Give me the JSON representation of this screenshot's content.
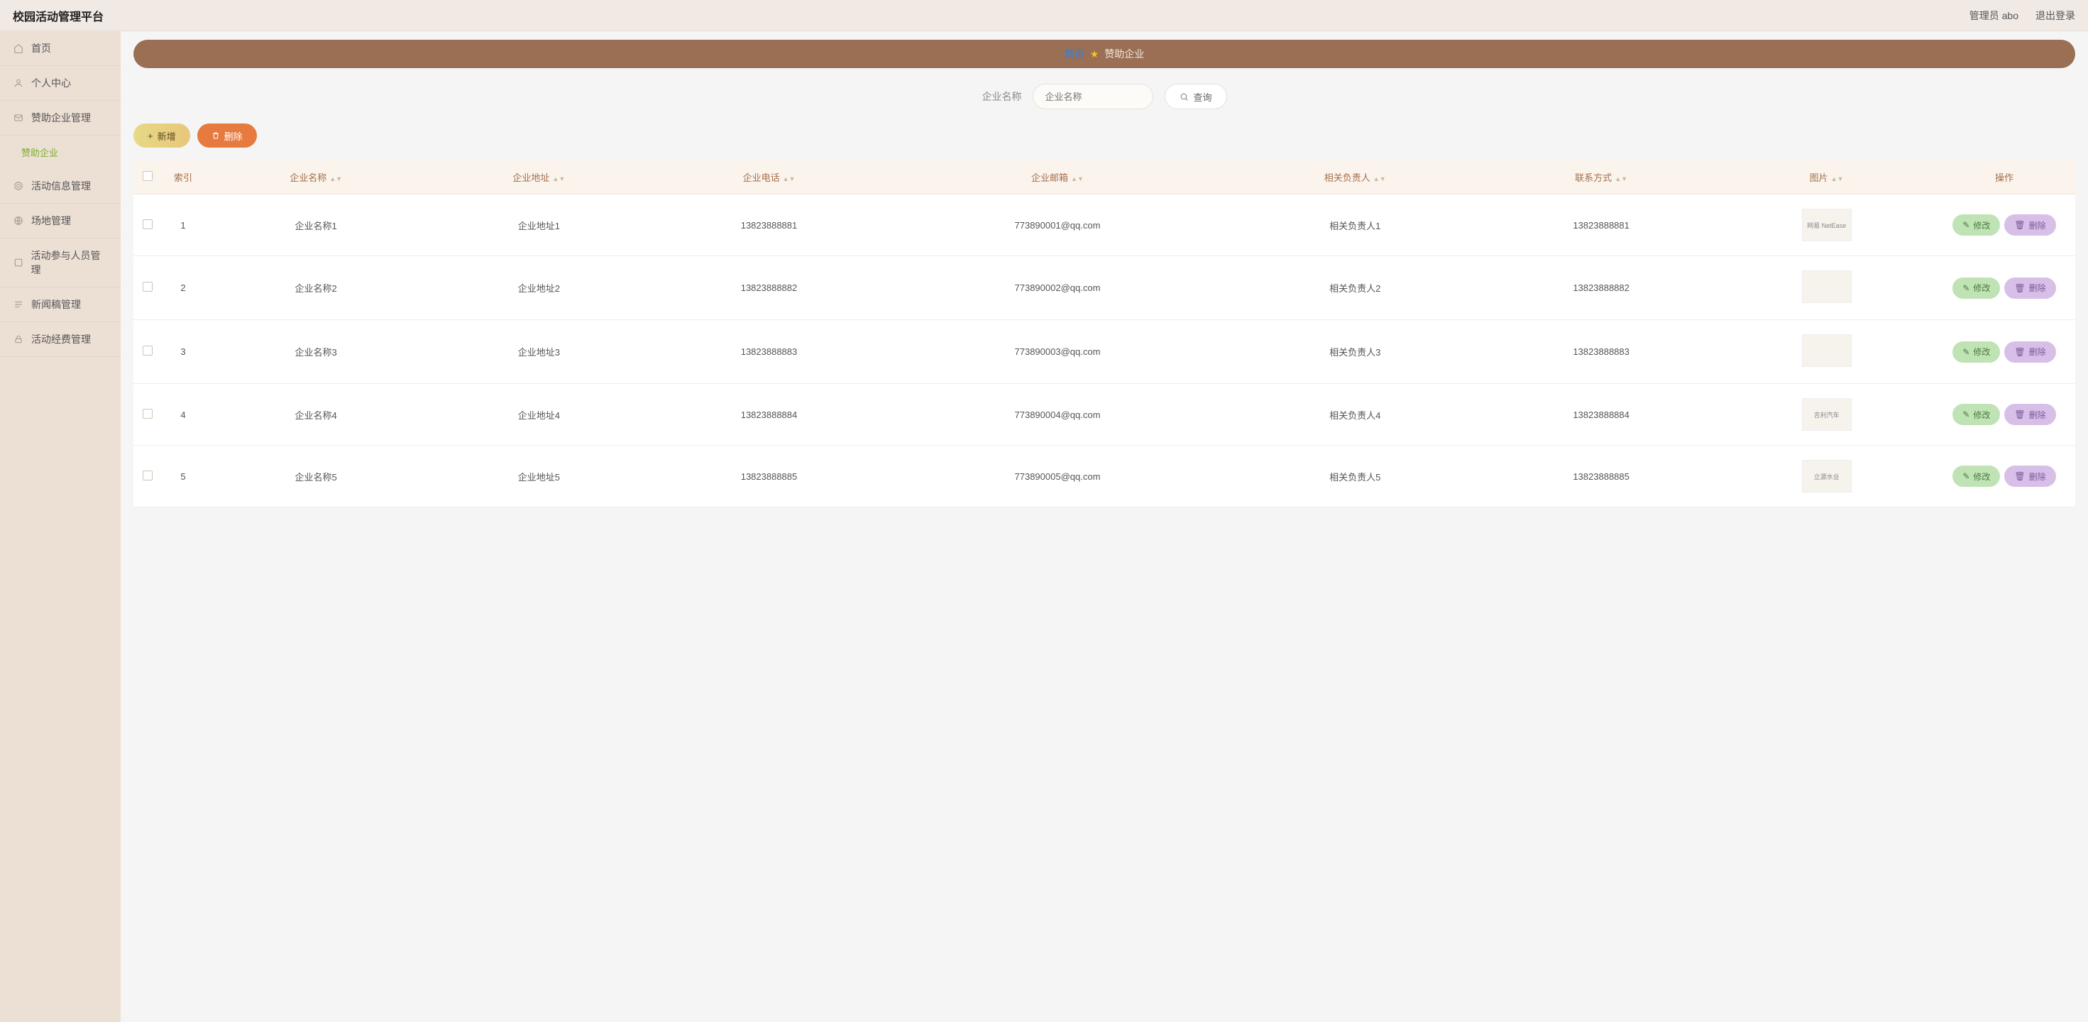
{
  "app": {
    "title": "校园活动管理平台"
  },
  "header": {
    "admin_label": "管理员 abo",
    "logout_label": "退出登录"
  },
  "sidebar": {
    "items": [
      {
        "icon": "home-icon",
        "label": "首页"
      },
      {
        "icon": "user-icon",
        "label": "个人中心"
      },
      {
        "icon": "mail-icon",
        "label": "赞助企业管理"
      },
      {
        "icon": "target-icon",
        "label": "活动信息管理"
      },
      {
        "icon": "globe-icon",
        "label": "场地管理"
      },
      {
        "icon": "people-icon",
        "label": "活动参与人员管理"
      },
      {
        "icon": "doc-icon",
        "label": "新闻稿管理"
      },
      {
        "icon": "lock-icon",
        "label": "活动经费管理"
      }
    ],
    "sub_active": "赞助企业"
  },
  "breadcrumb": {
    "home": "首页",
    "sep_star": "★",
    "current": "赞助企业"
  },
  "filter": {
    "label": "企业名称",
    "placeholder": "企业名称",
    "query_btn": "查询"
  },
  "actions": {
    "add": "新增",
    "delete": "删除"
  },
  "table": {
    "columns": [
      "索引",
      "企业名称",
      "企业地址",
      "企业电话",
      "企业邮箱",
      "相关负责人",
      "联系方式",
      "图片",
      "操作"
    ],
    "op_edit": "修改",
    "op_delete": "删除",
    "rows": [
      {
        "idx": "1",
        "name": "企业名称1",
        "addr": "企业地址1",
        "phone": "13823888881",
        "email": "773890001@qq.com",
        "person": "相关负责人1",
        "contact": "13823888881",
        "img": "网易 NetEase"
      },
      {
        "idx": "2",
        "name": "企业名称2",
        "addr": "企业地址2",
        "phone": "13823888882",
        "email": "773890002@qq.com",
        "person": "相关负责人2",
        "contact": "13823888882",
        "img": ""
      },
      {
        "idx": "3",
        "name": "企业名称3",
        "addr": "企业地址3",
        "phone": "13823888883",
        "email": "773890003@qq.com",
        "person": "相关负责人3",
        "contact": "13823888883",
        "img": ""
      },
      {
        "idx": "4",
        "name": "企业名称4",
        "addr": "企业地址4",
        "phone": "13823888884",
        "email": "773890004@qq.com",
        "person": "相关负责人4",
        "contact": "13823888884",
        "img": "吉利汽车"
      },
      {
        "idx": "5",
        "name": "企业名称5",
        "addr": "企业地址5",
        "phone": "13823888885",
        "email": "773890005@qq.com",
        "person": "相关负责人5",
        "contact": "13823888885",
        "img": "立源水业"
      }
    ]
  }
}
